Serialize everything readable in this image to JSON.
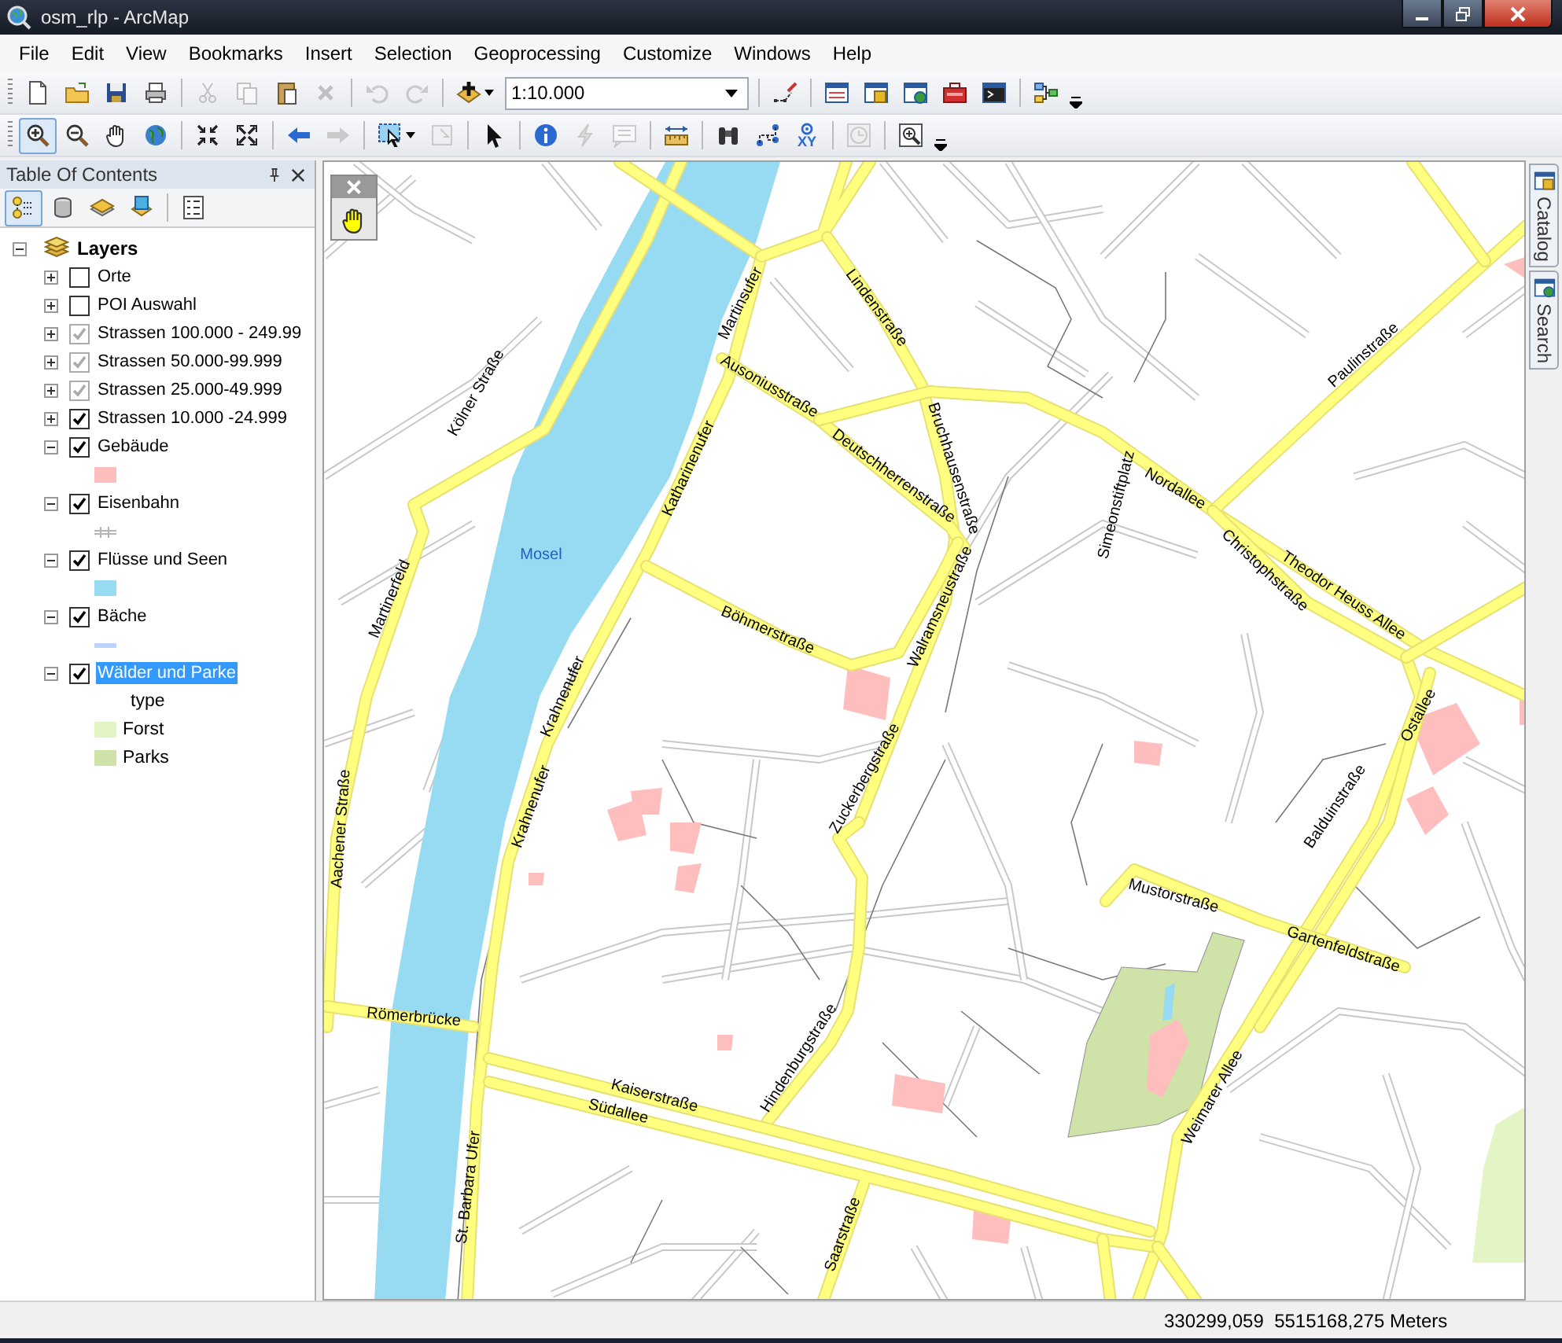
{
  "window": {
    "title": "osm_rlp - ArcMap"
  },
  "menu": [
    "File",
    "Edit",
    "View",
    "Bookmarks",
    "Insert",
    "Selection",
    "Geoprocessing",
    "Customize",
    "Windows",
    "Help"
  ],
  "toolbars": [
    [
      {
        "kind": "button",
        "disabled": false
      },
      {
        "kind": "button",
        "disabled": false
      },
      {
        "kind": "button",
        "disabled": false
      },
      {
        "kind": "button",
        "disabled": false
      },
      {
        "kind": "separator"
      },
      {
        "kind": "button",
        "disabled": true
      },
      {
        "kind": "button",
        "disabled": true
      },
      {
        "kind": "button",
        "disabled": false
      },
      {
        "kind": "button",
        "disabled": true
      },
      {
        "kind": "separator"
      },
      {
        "kind": "button",
        "disabled": true
      },
      {
        "kind": "button",
        "disabled": true
      },
      {
        "kind": "separator"
      },
      {
        "kind": "dropdown",
        "disabled": false
      },
      {
        "kind": "combo",
        "value": "1:10.000"
      },
      {
        "kind": "separator"
      },
      {
        "kind": "button",
        "disabled": false
      },
      {
        "kind": "separator"
      },
      {
        "kind": "button",
        "disabled": false
      },
      {
        "kind": "button",
        "disabled": false
      },
      {
        "kind": "button",
        "disabled": false
      },
      {
        "kind": "button",
        "disabled": false
      },
      {
        "kind": "button",
        "disabled": false
      },
      {
        "kind": "separator"
      },
      {
        "kind": "button",
        "disabled": false
      }
    ],
    [
      {
        "kind": "button",
        "disabled": false,
        "selected": true
      },
      {
        "kind": "button",
        "disabled": false,
        "selected": false
      },
      {
        "kind": "button",
        "disabled": false,
        "selected": false
      },
      {
        "kind": "button",
        "disabled": false,
        "selected": false
      },
      {
        "kind": "separator"
      },
      {
        "kind": "button",
        "disabled": false,
        "selected": false
      },
      {
        "kind": "button",
        "disabled": false,
        "selected": false
      },
      {
        "kind": "separator"
      },
      {
        "kind": "button",
        "disabled": false,
        "selected": false
      },
      {
        "kind": "button",
        "disabled": true,
        "selected": false
      },
      {
        "kind": "separator"
      },
      {
        "kind": "dropdown",
        "disabled": false,
        "selected": false
      },
      {
        "kind": "button",
        "disabled": true,
        "selected": false
      },
      {
        "kind": "separator"
      },
      {
        "kind": "button",
        "disabled": false,
        "selected": false
      },
      {
        "kind": "separator"
      },
      {
        "kind": "button",
        "disabled": false,
        "selected": false
      },
      {
        "kind": "button",
        "disabled": true,
        "selected": false
      },
      {
        "kind": "button",
        "disabled": true,
        "selected": false
      },
      {
        "kind": "separator"
      },
      {
        "kind": "button",
        "disabled": false,
        "selected": false
      },
      {
        "kind": "separator"
      },
      {
        "kind": "button",
        "disabled": false,
        "selected": false
      },
      {
        "kind": "button",
        "disabled": false,
        "selected": false
      },
      {
        "kind": "text-button",
        "text": "XY",
        "disabled": false,
        "selected": false
      },
      {
        "kind": "separator"
      },
      {
        "kind": "button",
        "disabled": true,
        "selected": false
      },
      {
        "kind": "separator"
      },
      {
        "kind": "button",
        "disabled": false,
        "selected": false
      }
    ]
  ],
  "toc": {
    "title": "Table Of Contents",
    "view_buttons": [
      {
        "selected": true
      },
      {
        "selected": false
      },
      {
        "selected": false
      },
      {
        "selected": false
      }
    ],
    "root": {
      "label": "Layers",
      "expanded": true,
      "children": [
        {
          "label": "Orte",
          "expanded": false,
          "checked": false,
          "disabled": false,
          "selected": false
        },
        {
          "label": "POI Auswahl",
          "expanded": false,
          "checked": false,
          "disabled": false,
          "selected": false
        },
        {
          "label": "Strassen 100.000 - 249.99",
          "expanded": false,
          "checked": true,
          "disabled": true,
          "selected": false
        },
        {
          "label": "Strassen 50.000-99.999",
          "expanded": false,
          "checked": true,
          "disabled": true,
          "selected": false
        },
        {
          "label": "Strassen 25.000-49.999",
          "expanded": false,
          "checked": true,
          "disabled": true,
          "selected": false
        },
        {
          "label": "Strassen 10.000 -24.999",
          "expanded": false,
          "checked": true,
          "disabled": false,
          "selected": false
        },
        {
          "label": "Gebäude",
          "expanded": true,
          "checked": true,
          "disabled": false,
          "selected": false,
          "legend": [
            {
              "kind": "fill",
              "color": "#ffbebe"
            }
          ]
        },
        {
          "label": "Eisenbahn",
          "expanded": true,
          "checked": true,
          "disabled": false,
          "selected": false,
          "legend": [
            {
              "kind": "rail",
              "color": "#b4b4b4"
            }
          ]
        },
        {
          "label": "Flüsse und Seen",
          "expanded": true,
          "checked": true,
          "disabled": false,
          "selected": false,
          "legend": [
            {
              "kind": "fill",
              "color": "#97dbf2"
            }
          ]
        },
        {
          "label": "Bäche",
          "expanded": true,
          "checked": true,
          "disabled": false,
          "selected": false,
          "legend": [
            {
              "kind": "line",
              "color": "#bed2ff"
            }
          ]
        },
        {
          "label": "Wälder und Parke",
          "expanded": true,
          "checked": true,
          "disabled": false,
          "selected": true,
          "legend_heading": "type",
          "legend": [
            {
              "kind": "fill",
              "color": "#e3f5c5",
              "label": "Forst"
            },
            {
              "kind": "fill",
              "color": "#cfe3a8",
              "label": "Parks"
            }
          ]
        }
      ]
    }
  },
  "map": {
    "labels": [
      {
        "text": "Kölner Straße",
        "kind": "street"
      },
      {
        "text": "Martinerfeld",
        "kind": "street"
      },
      {
        "text": "Mosel",
        "kind": "water"
      },
      {
        "text": "Martinsufer",
        "kind": "street"
      },
      {
        "text": "Lindenstraße",
        "kind": "street"
      },
      {
        "text": "Ausoniusstraße",
        "kind": "street"
      },
      {
        "text": "Deutschherrenstraße",
        "kind": "street"
      },
      {
        "text": "Katharinenufer",
        "kind": "street"
      },
      {
        "text": "Bruchhausenstraße",
        "kind": "street"
      },
      {
        "text": "Simeonstiftplatz",
        "kind": "street"
      },
      {
        "text": "Nordallee",
        "kind": "street"
      },
      {
        "text": "Paulinstraße",
        "kind": "street"
      },
      {
        "text": "Christophstraße",
        "kind": "street"
      },
      {
        "text": "Theodor Heuss Allee",
        "kind": "street"
      },
      {
        "text": "Böhmerstraße",
        "kind": "street"
      },
      {
        "text": "Walramsneustraße",
        "kind": "street"
      },
      {
        "text": "Ostallee",
        "kind": "street"
      },
      {
        "text": "Krahnenufer",
        "kind": "street"
      },
      {
        "text": "Zuckerbergstraße",
        "kind": "street"
      },
      {
        "text": "Balduinstraße",
        "kind": "street"
      },
      {
        "text": "Krahnenufer",
        "kind": "street"
      },
      {
        "text": "Aachener Straße",
        "kind": "street"
      },
      {
        "text": "Mustorstraße",
        "kind": "street"
      },
      {
        "text": "Gartenfeldstraße",
        "kind": "street"
      },
      {
        "text": "Römerbrücke",
        "kind": "street"
      },
      {
        "text": "Hindenburgstraße",
        "kind": "street"
      },
      {
        "text": "Weimarer Allee",
        "kind": "street"
      },
      {
        "text": "Kaiserstraße",
        "kind": "street"
      },
      {
        "text": "Südallee",
        "kind": "street"
      },
      {
        "text": "St. Barbara Ufer",
        "kind": "street"
      },
      {
        "text": "Saarstraße",
        "kind": "street"
      }
    ]
  },
  "dock_tabs": [
    {
      "label": "Catalog"
    },
    {
      "label": "Search"
    }
  ],
  "status_bar": {
    "coordinates": "330299,059  5515168,275 Meters"
  }
}
